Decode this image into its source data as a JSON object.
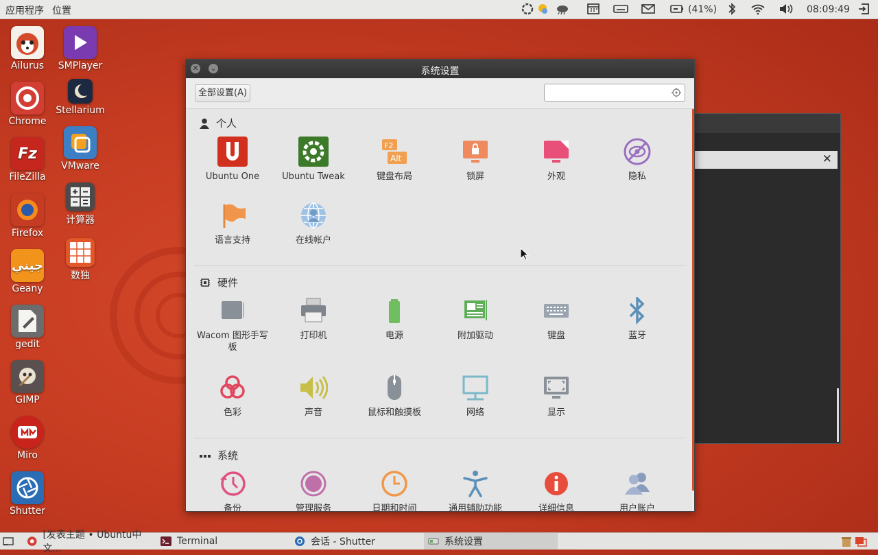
{
  "top_panel": {
    "menu_apps": "应用程序",
    "menu_places": "位置",
    "battery": "(41%)",
    "clock": "08:09:49"
  },
  "desktop_icons": [
    {
      "label": "Ailurus",
      "color": "#d44b2c"
    },
    {
      "label": "SMPlayer",
      "color": "#7a3bb0"
    },
    {
      "label": "Chrome",
      "color": "#d23e34"
    },
    {
      "label": "Stellarium",
      "color": "#1d2940"
    },
    {
      "label": "FileZilla",
      "color": "#c5271f"
    },
    {
      "label": "VMware",
      "color": "#e8912c"
    },
    {
      "label": "Firefox",
      "color": "#e06a1b"
    },
    {
      "label": "计算器",
      "color": "#4a4a4a"
    },
    {
      "label": "Geany",
      "color": "#f2931c"
    },
    {
      "label": "数独",
      "color": "#e2562a"
    },
    {
      "label": "gedit",
      "color": "#6c6c6c"
    },
    {
      "label": "GIMP",
      "color": "#5a5050"
    },
    {
      "label": "Miro",
      "color": "#c8241b"
    },
    {
      "label": "Shutter",
      "color": "#2a6db5"
    }
  ],
  "window": {
    "title": "系统设置",
    "all_settings": "全部设置(A)",
    "search_value": ""
  },
  "sections": {
    "personal": {
      "title": "个人",
      "items": [
        {
          "label": "Ubuntu One"
        },
        {
          "label": "Ubuntu Tweak"
        },
        {
          "label": "键盘布局"
        },
        {
          "label": "锁屏"
        },
        {
          "label": "外观"
        },
        {
          "label": "隐私"
        },
        {
          "label": "语言支持"
        },
        {
          "label": "在线帐户"
        }
      ]
    },
    "hardware": {
      "title": "硬件",
      "items": [
        {
          "label": "Wacom 图形手写板"
        },
        {
          "label": "打印机"
        },
        {
          "label": "电源"
        },
        {
          "label": "附加驱动"
        },
        {
          "label": "键盘"
        },
        {
          "label": "蓝牙"
        },
        {
          "label": "色彩"
        },
        {
          "label": "声音"
        },
        {
          "label": "鼠标和触摸板"
        },
        {
          "label": "网络"
        },
        {
          "label": "显示"
        }
      ]
    },
    "system": {
      "title": "系统",
      "items": [
        {
          "label": "备份"
        },
        {
          "label": "管理服务"
        },
        {
          "label": "日期和时间"
        },
        {
          "label": "通用辅助功能"
        },
        {
          "label": "详细信息"
        },
        {
          "label": "用户账户"
        }
      ]
    }
  },
  "taskbar": {
    "items": [
      {
        "label": "[发表主题 • Ubuntu中文..."
      },
      {
        "label": "Terminal"
      },
      {
        "label": "会话 - Shutter"
      },
      {
        "label": "系统设置"
      }
    ]
  }
}
